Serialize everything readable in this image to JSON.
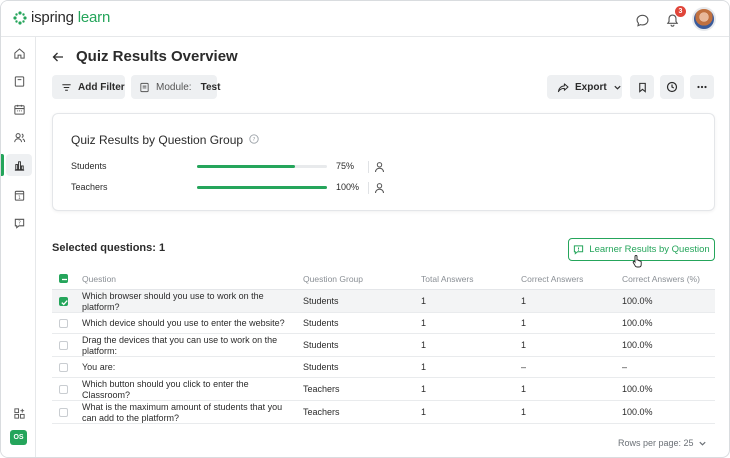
{
  "app": {
    "logo_part1": "ispring",
    "logo_part2": "learn",
    "notifications_count": "3",
    "user_initials": "OS"
  },
  "colors": {
    "accent": "#25a55b",
    "badge": "#e0453a"
  },
  "sidebar": {
    "items": [
      {
        "icon": "home-icon"
      },
      {
        "icon": "book-icon"
      },
      {
        "icon": "calendar-icon"
      },
      {
        "icon": "users-icon"
      },
      {
        "icon": "reports-chart-icon",
        "active": true
      },
      {
        "icon": "calendar-day-icon"
      },
      {
        "icon": "help-question-icon"
      }
    ],
    "bottom_icon": "add-widget-icon"
  },
  "header": {
    "title": "Quiz Results Overview",
    "filter_label": "Add Filter",
    "module_label": "Module:",
    "module_value": "Test",
    "export_label": "Export"
  },
  "card": {
    "title": "Quiz Results by Question Group",
    "groups": [
      {
        "name": "Students",
        "percent": 75,
        "label": "75%"
      },
      {
        "name": "Teachers",
        "percent": 100,
        "label": "100%"
      }
    ]
  },
  "selection": {
    "label": "Selected questions: 1",
    "learner_button": "Learner Results by Question"
  },
  "table": {
    "headers": [
      "Question",
      "Question Group",
      "Total Answers",
      "Correct Answers",
      "Correct Answers (%)"
    ],
    "rows": [
      {
        "selected": true,
        "q1": "Which browser should you use to work on the",
        "q2": "platform?",
        "group": "Students",
        "total": "1",
        "correct": "1",
        "pct": "100.0%"
      },
      {
        "selected": false,
        "q1": "Which device should you use to enter the website?",
        "q2": "",
        "group": "Students",
        "total": "1",
        "correct": "1",
        "pct": "100.0%"
      },
      {
        "selected": false,
        "q1": "Drag the devices that you can use to work on the",
        "q2": "platform:",
        "group": "Students",
        "total": "1",
        "correct": "1",
        "pct": "100.0%"
      },
      {
        "selected": false,
        "q1": "You are:",
        "q2": "",
        "group": "Students",
        "total": "1",
        "correct": "–",
        "pct": "–"
      },
      {
        "selected": false,
        "q1": "Which button should you click to enter the",
        "q2": "Classroom?",
        "group": "Teachers",
        "total": "1",
        "correct": "1",
        "pct": "100.0%"
      },
      {
        "selected": false,
        "q1": "What is the maximum amount of students that you",
        "q2": "can add to the platform?",
        "group": "Teachers",
        "total": "1",
        "correct": "1",
        "pct": "100.0%"
      }
    ]
  },
  "pagination": {
    "rows_per_page_label": "Rows per page: 25"
  }
}
